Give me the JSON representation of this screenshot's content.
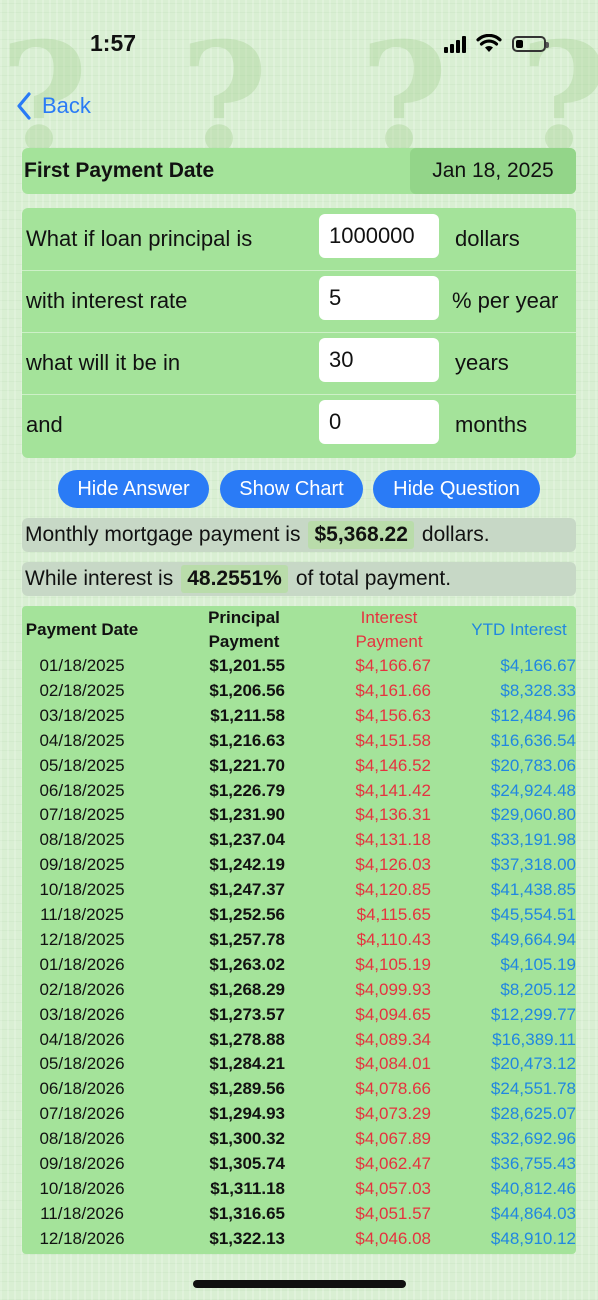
{
  "status": {
    "time": "1:57",
    "icons": [
      "signal-icon",
      "wifi-icon",
      "battery-icon"
    ]
  },
  "nav": {
    "back_label": "Back"
  },
  "first_payment": {
    "label": "First Payment Date",
    "value": "Jan 18, 2025"
  },
  "question": [
    {
      "label": "What if loan principal is",
      "value": "1000000",
      "unit": "dollars"
    },
    {
      "label": "with interest rate",
      "value": "5",
      "unit": "% per year"
    },
    {
      "label": "what will it be in",
      "value": "30",
      "unit": "years"
    },
    {
      "label": "and",
      "value": "0",
      "unit": "months"
    }
  ],
  "buttons": {
    "hide_answer": "Hide Answer",
    "show_chart": "Show Chart",
    "hide_question": "Hide Question"
  },
  "result": {
    "monthly_prefix": "Monthly mortgage payment is",
    "monthly_value": "$5,368.22",
    "monthly_suffix": "dollars.",
    "interest_prefix": "While interest is",
    "interest_value": "48.2551%",
    "interest_suffix": "of total payment."
  },
  "table": {
    "headers": {
      "date": "Payment Date",
      "principal": "Principal Payment",
      "interest": "Interest Payment",
      "ytd": "YTD Interest"
    },
    "rows": [
      [
        "01/18/2025",
        "$1,201.55",
        "$4,166.67",
        "$4,166.67"
      ],
      [
        "02/18/2025",
        "$1,206.56",
        "$4,161.66",
        "$8,328.33"
      ],
      [
        "03/18/2025",
        "$1,211.58",
        "$4,156.63",
        "$12,484.96"
      ],
      [
        "04/18/2025",
        "$1,216.63",
        "$4,151.58",
        "$16,636.54"
      ],
      [
        "05/18/2025",
        "$1,221.70",
        "$4,146.52",
        "$20,783.06"
      ],
      [
        "06/18/2025",
        "$1,226.79",
        "$4,141.42",
        "$24,924.48"
      ],
      [
        "07/18/2025",
        "$1,231.90",
        "$4,136.31",
        "$29,060.80"
      ],
      [
        "08/18/2025",
        "$1,237.04",
        "$4,131.18",
        "$33,191.98"
      ],
      [
        "09/18/2025",
        "$1,242.19",
        "$4,126.03",
        "$37,318.00"
      ],
      [
        "10/18/2025",
        "$1,247.37",
        "$4,120.85",
        "$41,438.85"
      ],
      [
        "11/18/2025",
        "$1,252.56",
        "$4,115.65",
        "$45,554.51"
      ],
      [
        "12/18/2025",
        "$1,257.78",
        "$4,110.43",
        "$49,664.94"
      ],
      [
        "01/18/2026",
        "$1,263.02",
        "$4,105.19",
        "$4,105.19"
      ],
      [
        "02/18/2026",
        "$1,268.29",
        "$4,099.93",
        "$8,205.12"
      ],
      [
        "03/18/2026",
        "$1,273.57",
        "$4,094.65",
        "$12,299.77"
      ],
      [
        "04/18/2026",
        "$1,278.88",
        "$4,089.34",
        "$16,389.11"
      ],
      [
        "05/18/2026",
        "$1,284.21",
        "$4,084.01",
        "$20,473.12"
      ],
      [
        "06/18/2026",
        "$1,289.56",
        "$4,078.66",
        "$24,551.78"
      ],
      [
        "07/18/2026",
        "$1,294.93",
        "$4,073.29",
        "$28,625.07"
      ],
      [
        "08/18/2026",
        "$1,300.32",
        "$4,067.89",
        "$32,692.96"
      ],
      [
        "09/18/2026",
        "$1,305.74",
        "$4,062.47",
        "$36,755.43"
      ],
      [
        "10/18/2026",
        "$1,311.18",
        "$4,057.03",
        "$40,812.46"
      ],
      [
        "11/18/2026",
        "$1,316.65",
        "$4,051.57",
        "$44,864.03"
      ],
      [
        "12/18/2026",
        "$1,322.13",
        "$4,046.08",
        "$48,910.12"
      ]
    ]
  },
  "colors": {
    "accent": "#2a7bf6",
    "interest": "#e5333f",
    "ytd": "#2187e0",
    "panel": "#a4e39a"
  }
}
